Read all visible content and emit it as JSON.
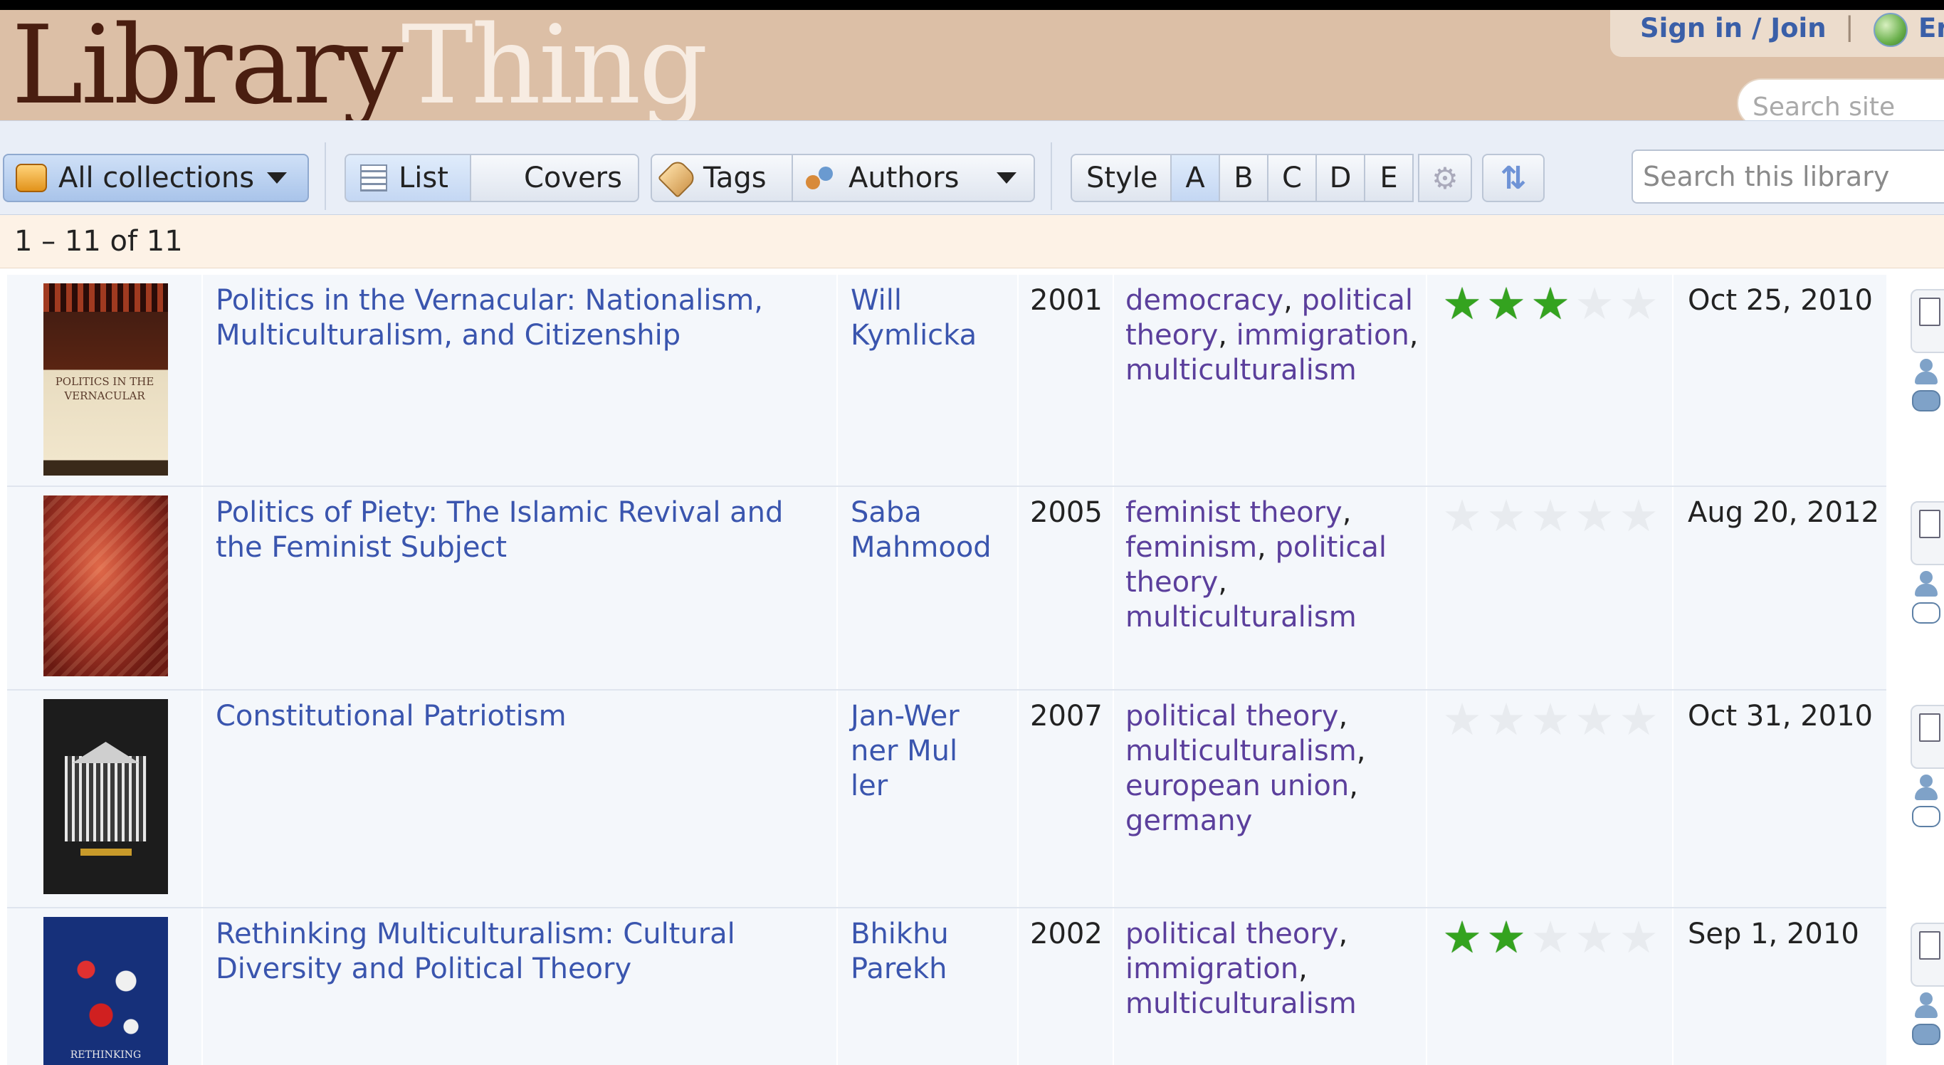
{
  "app": {
    "logo_part1": "Library",
    "logo_part2": "Thing",
    "signin_label": "Sign in / Join",
    "separator": "|",
    "language_fragment": "Er",
    "site_search_placeholder": "Search site"
  },
  "toolbar": {
    "collections_label": "All collections",
    "list_label": "List",
    "covers_label": "Covers",
    "tags_label": "Tags",
    "authors_label": "Authors",
    "style_label": "Style",
    "style_options": [
      "A",
      "B",
      "C",
      "D",
      "E"
    ],
    "style_selected": "A",
    "search_placeholder": "Search this library"
  },
  "results_count": "1 – 11 of 11",
  "books": [
    {
      "title": "Politics in the Vernacular: Nationalism, Multiculturalism, and Citizenship",
      "author": "Will Kymlicka",
      "year": "2001",
      "tags": [
        "democracy",
        "political theory",
        "immigration",
        "multiculturalism"
      ],
      "rating": 3,
      "date": "Oct 25, 2010",
      "cover_text": "POLITICS IN THE VERNACULAR"
    },
    {
      "title": "Politics of Piety: The Islamic Revival and the Feminist Subject",
      "author": "Saba Mahmood",
      "year": "2005",
      "tags": [
        "feminist theory",
        "feminism",
        "political theory",
        "multiculturalism"
      ],
      "rating": 0,
      "date": "Aug 20, 2012",
      "cover_text": ""
    },
    {
      "title": "Constitutional Patriotism",
      "author": "Jan-Werner Muller",
      "year": "2007",
      "tags": [
        "political theory",
        "multiculturalism",
        "european union",
        "germany"
      ],
      "rating": 0,
      "date": "Oct 31, 2010",
      "cover_text": ""
    },
    {
      "title": "Rethinking Multiculturalism: Cultural Diversity and Political Theory",
      "author": "Bhikhu Parekh",
      "year": "2002",
      "tags": [
        "political theory",
        "immigration",
        "multiculturalism"
      ],
      "rating": 2,
      "date": "Sep 1, 2010",
      "cover_text": "RETHINKING"
    }
  ],
  "colors": {
    "header_bg": "#dcbfa6",
    "link": "#3a55ae",
    "tag_link": "#5b3f9c",
    "star_on": "#34a31f"
  }
}
